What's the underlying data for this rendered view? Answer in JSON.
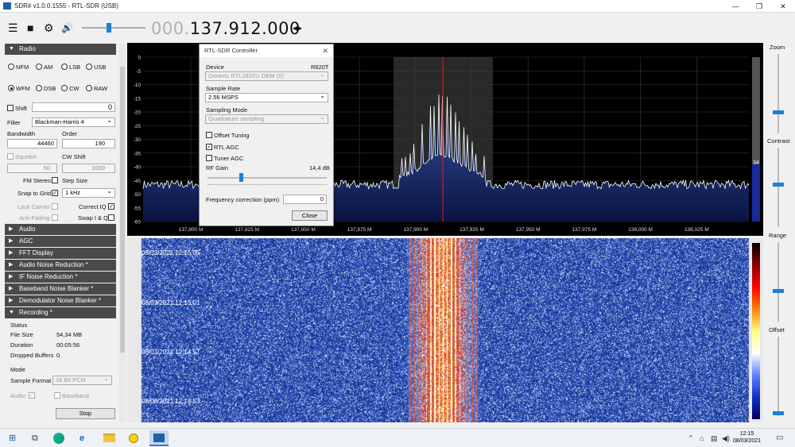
{
  "window": {
    "title": "SDR# v1.0.0.1555 - RTL-SDR (USB)",
    "minimize": "—",
    "maximize": "❐",
    "close": "✕"
  },
  "toolbar": {
    "menu_icon": "☰",
    "stop_icon": "■",
    "gear_icon": "⚙",
    "speaker_icon": "🔊",
    "frequency_dim": "000.",
    "frequency_main": "137.912.000",
    "tune_arrows": "◂▸"
  },
  "radio": {
    "header": "Radio",
    "modes_row1": [
      "NFM",
      "AM",
      "LSB",
      "USB"
    ],
    "modes_row2": [
      "WFM",
      "DSB",
      "CW",
      "RAW"
    ],
    "selected_mode": "WFM",
    "shift_label": "Shift",
    "shift_value": "0",
    "filter_label": "Filter",
    "filter_value": "Blackman-Harris 4",
    "bandwidth_label": "Bandwidth",
    "bandwidth_value": "44460",
    "order_label": "Order",
    "order_value": "190",
    "squelch_label": "Squelch",
    "squelch_value": "50",
    "cw_shift_label": "CW Shift",
    "cw_shift_value": "1000",
    "fm_stereo_label": "FM Stereo",
    "step_size_label": "Step Size",
    "snap_label": "Snap to Grid",
    "step_value": "1 kHz",
    "lock_carrier_label": "Lock Carrier",
    "correct_iq_label": "Correct IQ",
    "anti_fading_label": "Anti-Fading",
    "swap_iq_label": "Swap I & Q"
  },
  "collapsed_sections": [
    "Audio",
    "AGC",
    "FFT Display",
    "Audio Noise Reduction *",
    "IF Noise Reduction *",
    "Baseband Noise Blanker *",
    "Demodulator Noise Blanker *"
  ],
  "recording": {
    "header": "Recording *",
    "status_label": "Status",
    "file_size_label": "File Size",
    "file_size_value": "54,34 MB",
    "duration_label": "Duration",
    "duration_value": "00:05:56",
    "dropped_label": "Dropped Buffers",
    "dropped_value": "0",
    "mode_label": "Mode",
    "sample_format_label": "Sample Format",
    "sample_format_value": "16 Bit PCM",
    "audio_label": "Audio",
    "baseband_label": "Baseband",
    "stop_button": "Stop"
  },
  "spectrum": {
    "y_ticks": [
      "0",
      "-5",
      "-10",
      "-15",
      "-20",
      "-25",
      "-30",
      "-35",
      "-40",
      "-45",
      "-50",
      "-55",
      "-60"
    ],
    "x_ticks": [
      "137,800 M",
      "137,825 M",
      "137,850 M",
      "137,875 M",
      "137,900 M",
      "137,925 M",
      "137,950 M",
      "137,975 M",
      "138,000 M",
      "138,025 M"
    ],
    "level_value": "34"
  },
  "waterfall": {
    "timestamps": [
      "08/03/2021 12:15:05",
      "08/03/2021 12:15:01",
      "08/03/2021 12:14:57",
      "08/03/2021 12:14:53"
    ]
  },
  "right_panel": {
    "zoom": "Zoom",
    "contrast": "Contrast",
    "range": "Range",
    "offset": "Offset"
  },
  "dialog": {
    "title": "RTL-SDR Controller",
    "device_label": "Device",
    "device_tuner": "R820T",
    "device_value": "Generic RTL2832U OEM (0)",
    "sample_rate_label": "Sample Rate",
    "sample_rate_value": "2.56 MSPS",
    "sampling_mode_label": "Sampling Mode",
    "sampling_mode_value": "Quadrature sampling",
    "offset_tuning_label": "Offset Tuning",
    "rtl_agc_label": "RTL AGC",
    "tuner_agc_label": "Tuner AGC",
    "rf_gain_label": "RF Gain",
    "rf_gain_value": "14,4 dB",
    "freq_corr_label": "Frequency correction (ppm)",
    "freq_corr_value": "0",
    "close_button": "Close"
  },
  "taskbar": {
    "time": "12:15",
    "date": "08/03/2021",
    "tray_chevron": "^"
  }
}
